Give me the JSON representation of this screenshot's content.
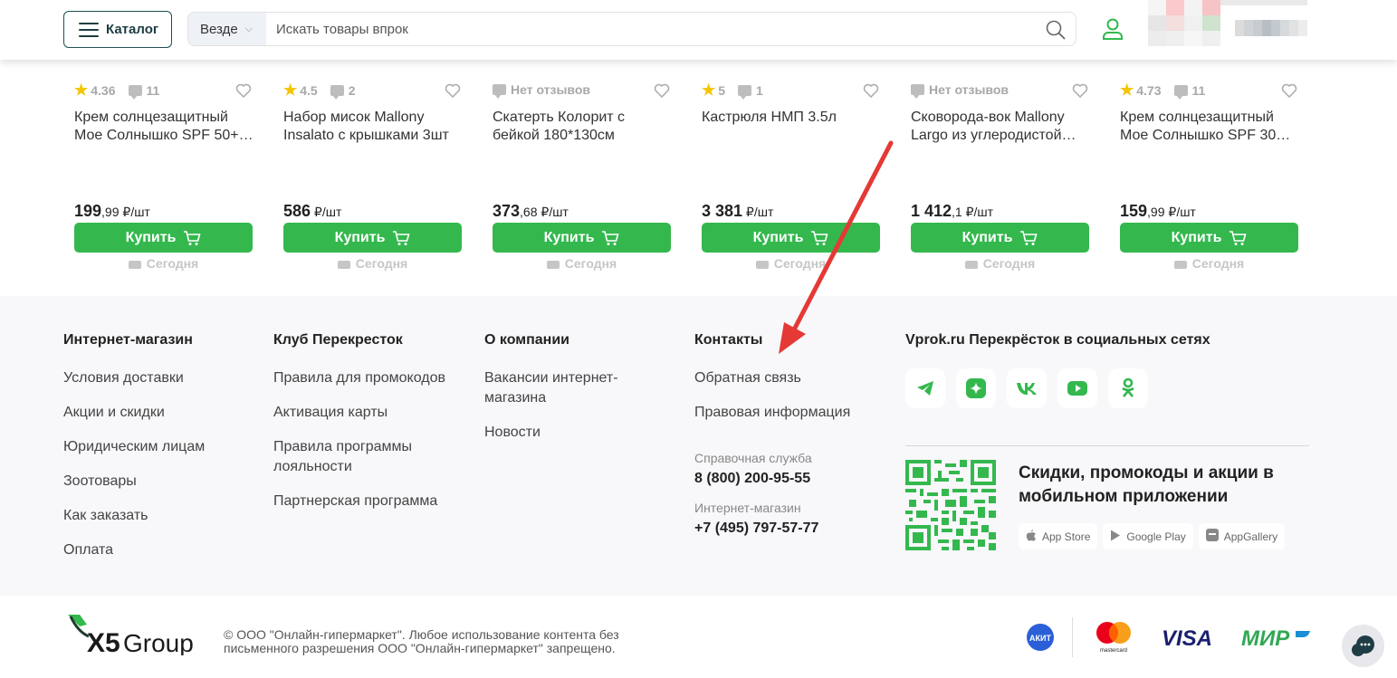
{
  "header": {
    "catalog_label": "Каталог",
    "search_scope": "Везде",
    "search_placeholder": "Искать товары впрок"
  },
  "products": [
    {
      "rating": "4.36",
      "reviews": "11",
      "name": "Крем солнцезащитный Мое Солнышко SPF 50+…",
      "price_main": "199",
      "price_kop": ",99",
      "unit": " ₽/шт",
      "buy": "Купить",
      "delivery": "Сегодня"
    },
    {
      "rating": "4.5",
      "reviews": "2",
      "name": "Набор мисок Mallony Insalato с крышками 3шт",
      "price_main": "586",
      "price_kop": "",
      "unit": " ₽/шт",
      "buy": "Купить",
      "delivery": "Сегодня"
    },
    {
      "rating": "",
      "reviews": "Нет отзывов",
      "name": "Скатерть Колорит с бейкой 180*130см",
      "price_main": "373",
      "price_kop": ",68",
      "unit": " ₽/шт",
      "buy": "Купить",
      "delivery": "Сегодня"
    },
    {
      "rating": "5",
      "reviews": "1",
      "name": "Кастрюля НМП 3.5л",
      "price_main": "3 381",
      "price_kop": "",
      "unit": " ₽/шт",
      "buy": "Купить",
      "delivery": "Сегодня"
    },
    {
      "rating": "",
      "reviews": "Нет отзывов",
      "name": "Сковорода-вок Mallony Largo из углеродистой…",
      "price_main": "1 412",
      "price_kop": ",1",
      "unit": " ₽/шт",
      "buy": "Купить",
      "delivery": "Сегодня"
    },
    {
      "rating": "4.73",
      "reviews": "11",
      "name": "Крем солнцезащитный Мое Солнышко SPF 30…",
      "price_main": "159",
      "price_kop": ",99",
      "unit": " ₽/шт",
      "buy": "Купить",
      "delivery": "Сегодня"
    }
  ],
  "footer": {
    "shop": {
      "title": "Интернет-магазин",
      "links": [
        "Условия доставки",
        "Акции и скидки",
        "Юридическим лицам",
        "Зоотовары",
        "Как заказать",
        "Оплата"
      ]
    },
    "club": {
      "title": "Клуб Перекресток",
      "links": [
        "Правила для промокодов",
        "Активация карты",
        "Правила программы лояльности",
        "Партнерская программа"
      ]
    },
    "company": {
      "title": "О компании",
      "links": [
        "Вакансии интернет-магазина",
        "Новости"
      ]
    },
    "contacts": {
      "title": "Контакты",
      "links": [
        "Обратная связь",
        "Правовая информация"
      ],
      "help_label": "Справочная служба",
      "help_phone": "8 (800) 200-95-55",
      "shop_label": "Интернет-магазин",
      "shop_phone": "+7 (495) 797-57-77"
    },
    "social": {
      "title": "Vprok.ru Перекрёсток в социальных сетях",
      "icons": [
        "telegram-icon",
        "zen-icon",
        "vk-icon",
        "youtube-icon",
        "odnoklassniki-icon"
      ]
    },
    "app": {
      "text": "Скидки, промокоды и акции в мобильном приложении",
      "stores": [
        "App Store",
        "Google Play",
        "AppGallery"
      ]
    }
  },
  "bottom": {
    "logo_text": "X5Group",
    "copyright": "© ООО \"Онлайн-гипермаркет\". Любое использование контента без письменного разрешения ООО \"Онлайн-гипермаркет\" запрещено.",
    "payments": [
      "АКИТ",
      "mastercard",
      "VISA",
      "МИР"
    ]
  },
  "colors": {
    "accent_green": "#34b84e",
    "annotation_arrow": "#e53935"
  }
}
